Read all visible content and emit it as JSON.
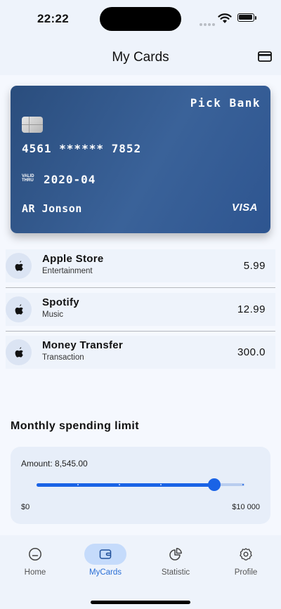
{
  "status_bar": {
    "time": "22:22",
    "icons": [
      "signal-dots-icon",
      "wifi-icon",
      "battery-icon"
    ]
  },
  "header": {
    "title": "My Cards",
    "action_icon": "credit-card-icon"
  },
  "card": {
    "bank_name": "Pick Bank",
    "number": "4561 ****** 7852",
    "valid_label": "VALID THRU",
    "valid_thru": "2020-04",
    "holder": "AR Jonson",
    "network": "VISA",
    "colors": {
      "start": "#2a4d7d",
      "end": "#3a6299"
    }
  },
  "transactions": [
    {
      "name": "Apple Store",
      "category": "Entertainment",
      "amount": "5.99",
      "icon": "apple-icon"
    },
    {
      "name": "Spotify",
      "category": "Music",
      "amount": "12.99",
      "icon": "apple-icon"
    },
    {
      "name": "Money Transfer",
      "category": "Transaction",
      "amount": "300.0",
      "icon": "apple-icon"
    }
  ],
  "spending_limit": {
    "title": "Monthly spending limit",
    "amount_label": "Amount: 8,545.00",
    "min_label": "$0",
    "max_label": "$10 000",
    "value": 8545,
    "max": 10000,
    "accent": "#1a63e6"
  },
  "bottom_nav": {
    "items": [
      {
        "label": "Home",
        "icon": "home-icon",
        "active": false
      },
      {
        "label": "MyCards",
        "icon": "wallet-icon",
        "active": true
      },
      {
        "label": "Statistic",
        "icon": "pie-chart-icon",
        "active": false
      },
      {
        "label": "Profile",
        "icon": "gear-icon",
        "active": false
      }
    ]
  }
}
